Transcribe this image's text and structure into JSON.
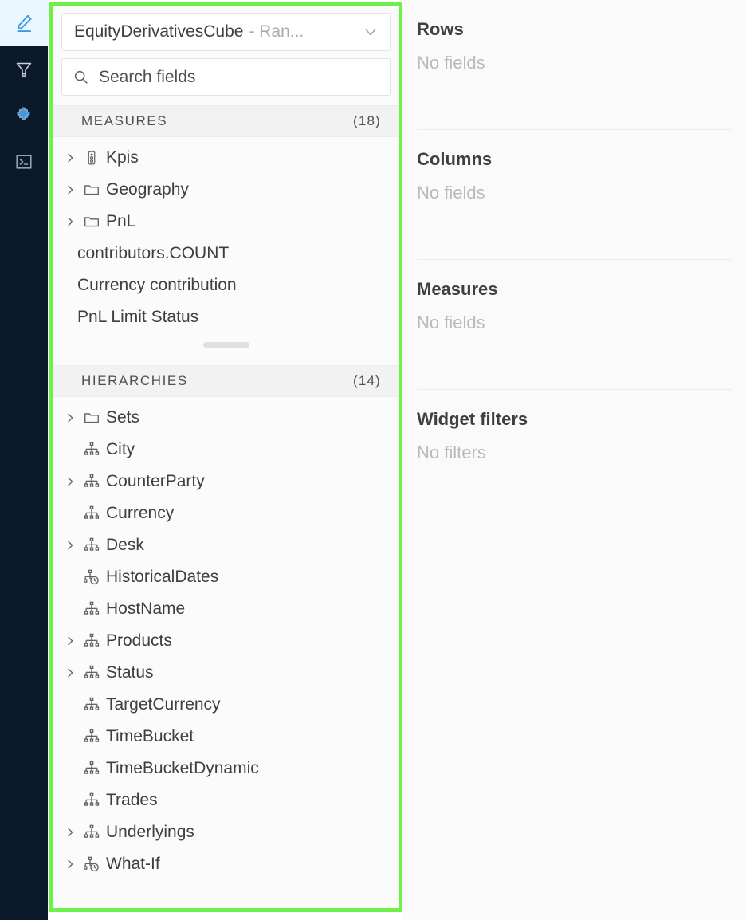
{
  "rail": {
    "items": [
      {
        "name": "edit-pencil-icon",
        "label": "Edit",
        "active": true
      },
      {
        "name": "filter-funnel-icon",
        "label": "Filters",
        "active": false
      },
      {
        "name": "puzzle-piece-icon",
        "label": "Plugins",
        "active": false
      },
      {
        "name": "terminal-icon",
        "label": "Console",
        "active": false
      }
    ]
  },
  "colors": {
    "highlight": "#6ef04a",
    "rail_background": "#0b1a2b",
    "rail_active_background": "#e9f8ff",
    "accent_blue": "#3c9ae8"
  },
  "fields_panel": {
    "cube_selector": {
      "name": "EquityDerivativesCube",
      "suffix": "- Ran...",
      "chevron": "chevron-down-icon"
    },
    "search": {
      "placeholder": "Search fields",
      "value": "",
      "icon": "search-icon"
    },
    "sections": [
      {
        "id": "measures",
        "title": "MEASURES",
        "count": "(18)",
        "items": [
          {
            "label": "Kpis",
            "icon": "kpi-icon",
            "expandable": true
          },
          {
            "label": "Geography",
            "icon": "folder-icon",
            "expandable": true
          },
          {
            "label": "PnL",
            "icon": "folder-icon",
            "expandable": true
          },
          {
            "label": "contributors.COUNT",
            "icon": "none",
            "expandable": false
          },
          {
            "label": "Currency contribution",
            "icon": "none",
            "expandable": false
          },
          {
            "label": "PnL Limit Status",
            "icon": "none",
            "expandable": false
          }
        ]
      },
      {
        "id": "hierarchies",
        "title": "HIERARCHIES",
        "count": "(14)",
        "items": [
          {
            "label": "Sets",
            "icon": "folder-icon",
            "expandable": true
          },
          {
            "label": "City",
            "icon": "hierarchy-icon",
            "expandable": false
          },
          {
            "label": "CounterParty",
            "icon": "hierarchy-icon",
            "expandable": true
          },
          {
            "label": "Currency",
            "icon": "hierarchy-icon",
            "expandable": false
          },
          {
            "label": "Desk",
            "icon": "hierarchy-icon",
            "expandable": true
          },
          {
            "label": "HistoricalDates",
            "icon": "time-hierarchy-icon",
            "expandable": false
          },
          {
            "label": "HostName",
            "icon": "hierarchy-icon",
            "expandable": false
          },
          {
            "label": "Products",
            "icon": "hierarchy-icon",
            "expandable": true
          },
          {
            "label": "Status",
            "icon": "hierarchy-icon",
            "expandable": true
          },
          {
            "label": "TargetCurrency",
            "icon": "hierarchy-icon",
            "expandable": false
          },
          {
            "label": "TimeBucket",
            "icon": "hierarchy-icon",
            "expandable": false
          },
          {
            "label": "TimeBucketDynamic",
            "icon": "hierarchy-icon",
            "expandable": false
          },
          {
            "label": "Trades",
            "icon": "hierarchy-icon",
            "expandable": false
          },
          {
            "label": "Underlyings",
            "icon": "hierarchy-icon",
            "expandable": true
          },
          {
            "label": "What-If",
            "icon": "time-hierarchy-icon",
            "expandable": true
          }
        ]
      }
    ]
  },
  "right_panel": {
    "sections": [
      {
        "title": "Rows",
        "empty": "No fields"
      },
      {
        "title": "Columns",
        "empty": "No fields"
      },
      {
        "title": "Measures",
        "empty": "No fields"
      },
      {
        "title": "Widget filters",
        "empty": "No filters"
      }
    ]
  }
}
